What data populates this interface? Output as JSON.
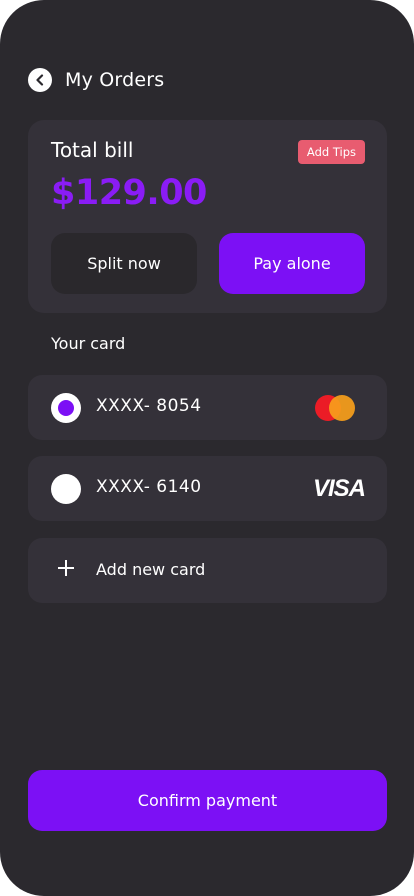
{
  "header": {
    "title": "My Orders",
    "back_icon": "chevron-left-icon"
  },
  "bill": {
    "label": "Total bill",
    "tips_label": "Add Tips",
    "amount": "$129.00",
    "split_label": "Split now",
    "pay_label": "Pay alone"
  },
  "cards": {
    "section_label": "Your card",
    "items": [
      {
        "number": "XXXX- 8054",
        "brand": "mastercard-logo",
        "selected": true
      },
      {
        "number": "XXXX- 6140",
        "brand": "visa-logo",
        "brand_text": "VISA",
        "selected": false
      }
    ],
    "add_label": "Add new card"
  },
  "footer": {
    "confirm_label": "Confirm payment"
  },
  "colors": {
    "background": "#2b292e",
    "surface": "#343139",
    "accent": "#7c10f5",
    "amount": "#8a1cf5",
    "tips_badge": "#e85c70"
  }
}
